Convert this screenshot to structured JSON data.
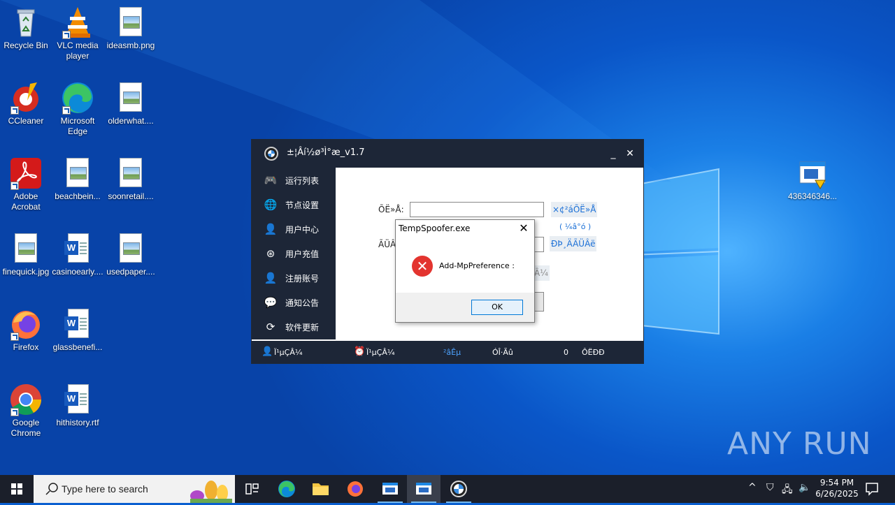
{
  "desktop": {
    "icons": [
      {
        "label": "Recycle Bin",
        "icon": "recycle-bin-icon"
      },
      {
        "label": "VLC media player",
        "icon": "vlc-icon"
      },
      {
        "label": "ideasmb.png",
        "icon": "image-file-icon"
      },
      {
        "label": "CCleaner",
        "icon": "ccleaner-icon"
      },
      {
        "label": "Microsoft Edge",
        "icon": "edge-icon"
      },
      {
        "label": "olderwhat....",
        "icon": "image-file-icon"
      },
      {
        "label": "Adobe Acrobat",
        "icon": "acrobat-icon"
      },
      {
        "label": "beachbein...",
        "icon": "image-file-icon"
      },
      {
        "label": "soonretail....",
        "icon": "image-file-icon"
      },
      {
        "label": "finequick.jpg",
        "icon": "image-file-icon"
      },
      {
        "label": "casinoearly....",
        "icon": "word-file-icon"
      },
      {
        "label": "usedpaper....",
        "icon": "image-file-icon"
      },
      {
        "label": "Firefox",
        "icon": "firefox-icon"
      },
      {
        "label": "glassbenefi...",
        "icon": "word-file-icon"
      },
      {
        "label": "Google Chrome",
        "icon": "chrome-icon"
      },
      {
        "label": "hithistory.rtf",
        "icon": "word-file-icon"
      },
      {
        "label": "436346346...",
        "icon": "exe-file-icon"
      }
    ]
  },
  "app": {
    "title": "±¦Âí½ø³Ì°æ_v1.7",
    "min_label": "_",
    "close_label": "✕",
    "nav": [
      {
        "label": "运行列表",
        "icon": "gamepad-icon"
      },
      {
        "label": "节点设置",
        "icon": "globe-icon"
      },
      {
        "label": "用户中心",
        "icon": "user-icon"
      },
      {
        "label": "用户充值",
        "icon": "recharge-icon"
      },
      {
        "label": "注册账号",
        "icon": "add-user-icon"
      },
      {
        "label": "通知公告",
        "icon": "wechat-icon"
      },
      {
        "label": "软件更新",
        "icon": "refresh-icon"
      }
    ],
    "form": {
      "field1_label": "ÕË»Å:",
      "field1_link": "×¢²áÕË»Å",
      "field1_hint": "( ¼â°ó )",
      "field2_label": "ÃÜÂ",
      "field2_link": "ÐÞ¸ÄÃÜÂë",
      "third_link": "Â¼"
    },
    "status": {
      "item1": "Ï¹µÇÂ¼",
      "item2": "Ï¹µÇÂ¼",
      "item3": "²âÊµ",
      "item4": "ÓÎ·Ãû",
      "count": "0",
      "item5": "ÔËÐÐ"
    }
  },
  "messagebox": {
    "title": "TempSpoofer.exe",
    "message": "Add-MpPreference :",
    "ok_label": "OK"
  },
  "watermark": "ANY RUN",
  "taskbar": {
    "search_placeholder": "Type here to search",
    "time": "9:54 PM",
    "date": "6/26/2025"
  }
}
